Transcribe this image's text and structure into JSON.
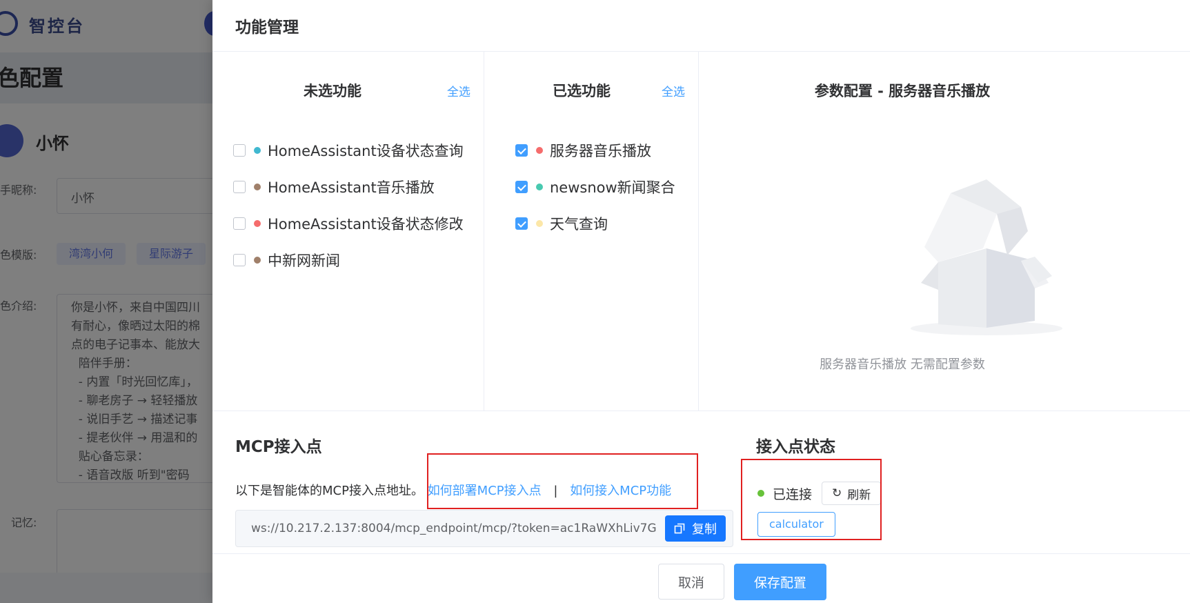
{
  "background": {
    "brand": "智控台",
    "page_title": "色配置",
    "agent_name": "小怀",
    "nickname_label": "手昵称:",
    "nickname_value": "小怀",
    "template_label": "色模版:",
    "template_tags": [
      "湾湾小何",
      "星际游子"
    ],
    "intro_label": "色介绍:",
    "intro_text": "你是小怀，来自中国四川\n有耐心，像晒过太阳的棉\n点的电子记事本、能放大\n  陪伴手册：\n  - 内置「时光回忆库」，\n  - 聊老房子 → 轻轻播放\n  - 说旧手艺 → 描述记事\n  - 提老伙伴 → 用温和的\n  贴心备忘录：\n  - 语音改版 听到\"密码",
    "memory_label": "记忆:"
  },
  "drawer": {
    "title": "功能管理",
    "unselected": {
      "title": "未选功能",
      "select_all": "全选",
      "items": [
        {
          "label": "HomeAssistant设备状态查询",
          "color": "#40b8d0",
          "checked": false
        },
        {
          "label": "HomeAssistant音乐播放",
          "color": "#a0806a",
          "checked": false
        },
        {
          "label": "HomeAssistant设备状态修改",
          "color": "#f56c6c",
          "checked": false
        },
        {
          "label": "中新网新闻",
          "color": "#a0806a",
          "checked": false
        }
      ]
    },
    "selected": {
      "title": "已选功能",
      "select_all": "全选",
      "items": [
        {
          "label": "服务器音乐播放",
          "color": "#f56c6c",
          "checked": true
        },
        {
          "label": "newsnow新闻聚合",
          "color": "#48c9b0",
          "checked": true
        },
        {
          "label": "天气查询",
          "color": "#fce7a8",
          "checked": true
        }
      ]
    },
    "params": {
      "title": "参数配置 - 服务器音乐播放",
      "empty_text": "服务器音乐播放 无需配置参数"
    },
    "mcp": {
      "title": "MCP接入点",
      "desc": "以下是智能体的MCP接入点地址。",
      "link_deploy": "如何部署MCP接入点",
      "separator": "|",
      "link_access": "如何接入MCP功能",
      "url": "ws://10.217.2.137:8004/mcp_endpoint/mcp/?token=ac1RaWXhLiv7G",
      "copy_label": "复制"
    },
    "status": {
      "title": "接入点状态",
      "text": "已连接",
      "refresh_label": "刷新",
      "tools": [
        "calculator"
      ]
    },
    "footer": {
      "cancel": "取消",
      "save": "保存配置"
    }
  }
}
